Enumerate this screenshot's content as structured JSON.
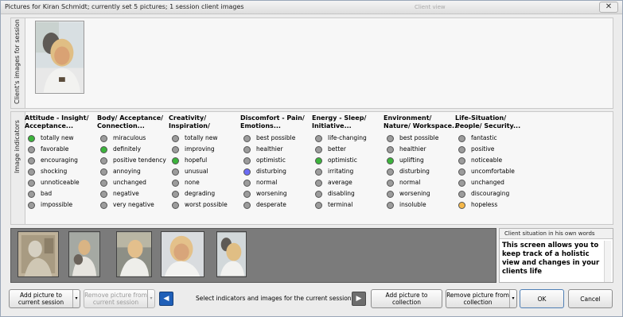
{
  "window": {
    "title": "Pictures for Kiran Schmidt; currently set 5 pictures; 1 session client images",
    "ghost_title": "Client view",
    "close_label": "✕"
  },
  "client_images_tab": "Client's images for session",
  "indicators_tab": "Image indicators",
  "colors": {
    "gray": "#9c9c9c",
    "green": "#3cb43c",
    "blue": "#6b6bf5",
    "orange": "#f5b84a",
    "nav_blue": "#1f5fb8",
    "nav_gray": "#6d6d6d"
  },
  "indicator_columns": [
    {
      "header1": "Attitude - Insight/",
      "header2": "Acceptance...",
      "items": [
        {
          "label": "totally new",
          "state": "green"
        },
        {
          "label": "favorable",
          "state": "gray"
        },
        {
          "label": "encouraging",
          "state": "gray"
        },
        {
          "label": "shocking",
          "state": "gray"
        },
        {
          "label": "unnoticeable",
          "state": "gray"
        },
        {
          "label": "bad",
          "state": "gray"
        },
        {
          "label": "impossible",
          "state": "gray"
        }
      ]
    },
    {
      "header1": "Body/ Acceptance/",
      "header2": "Connection...",
      "items": [
        {
          "label": "miraculous",
          "state": "gray"
        },
        {
          "label": "definitely",
          "state": "green"
        },
        {
          "label": "positive tendency",
          "state": "gray"
        },
        {
          "label": "annoying",
          "state": "gray"
        },
        {
          "label": "unchanged",
          "state": "gray"
        },
        {
          "label": "negative",
          "state": "gray"
        },
        {
          "label": "very negative",
          "state": "gray"
        }
      ]
    },
    {
      "header1": "Creativity/",
      "header2": "Inspiration/",
      "items": [
        {
          "label": "totally new",
          "state": "gray"
        },
        {
          "label": "improving",
          "state": "gray"
        },
        {
          "label": "hopeful",
          "state": "green"
        },
        {
          "label": "unusual",
          "state": "gray"
        },
        {
          "label": "none",
          "state": "gray"
        },
        {
          "label": "degrading",
          "state": "gray"
        },
        {
          "label": "worst possible",
          "state": "gray"
        }
      ]
    },
    {
      "header1": "Discomfort - Pain/",
      "header2": "Emotions...",
      "items": [
        {
          "label": "best possible",
          "state": "gray"
        },
        {
          "label": "healthier",
          "state": "gray"
        },
        {
          "label": "optimistic",
          "state": "gray"
        },
        {
          "label": "disturbing",
          "state": "blue"
        },
        {
          "label": "normal",
          "state": "gray"
        },
        {
          "label": "worsening",
          "state": "gray"
        },
        {
          "label": "desperate",
          "state": "gray"
        }
      ]
    },
    {
      "header1": "Energy - Sleep/",
      "header2": "Initiative...",
      "items": [
        {
          "label": "life-changing",
          "state": "gray"
        },
        {
          "label": "better",
          "state": "gray"
        },
        {
          "label": "optimistic",
          "state": "green"
        },
        {
          "label": "irritating",
          "state": "gray"
        },
        {
          "label": "average",
          "state": "gray"
        },
        {
          "label": "disabling",
          "state": "gray"
        },
        {
          "label": "terminal",
          "state": "gray"
        }
      ]
    },
    {
      "header1": "Environment/",
      "header2": "Nature/ Workspace...",
      "items": [
        {
          "label": "best possible",
          "state": "gray"
        },
        {
          "label": "healthier",
          "state": "gray"
        },
        {
          "label": "uplifting",
          "state": "green"
        },
        {
          "label": "disturbing",
          "state": "gray"
        },
        {
          "label": "normal",
          "state": "gray"
        },
        {
          "label": "worsening",
          "state": "gray"
        },
        {
          "label": "insoluble",
          "state": "gray"
        }
      ]
    },
    {
      "header1": "Life-Situation/",
      "header2": "People/ Security...",
      "items": [
        {
          "label": "fantastic",
          "state": "gray"
        },
        {
          "label": "positive",
          "state": "gray"
        },
        {
          "label": "noticeable",
          "state": "gray"
        },
        {
          "label": "uncomfortable",
          "state": "gray"
        },
        {
          "label": "unchanged",
          "state": "gray"
        },
        {
          "label": "discouraging",
          "state": "gray"
        },
        {
          "label": "hopeless",
          "state": "orange"
        }
      ]
    }
  ],
  "situation": {
    "header": "Client situation in his own words",
    "text": "This screen allows you to keep track of a holistic view and changes in your clients life"
  },
  "buttons": {
    "add_to_session": "Add picture to current session",
    "remove_from_session": "Remove picture from current session",
    "hint": "Select indicators and images for the current session",
    "add_to_collection": "Add picture to collection",
    "remove_from_collection": "Remove picture from collection",
    "ok": "OK",
    "cancel": "Cancel",
    "dropdown_glyph": "▾",
    "nav_left_glyph": "◀",
    "nav_right_glyph": "▶"
  }
}
